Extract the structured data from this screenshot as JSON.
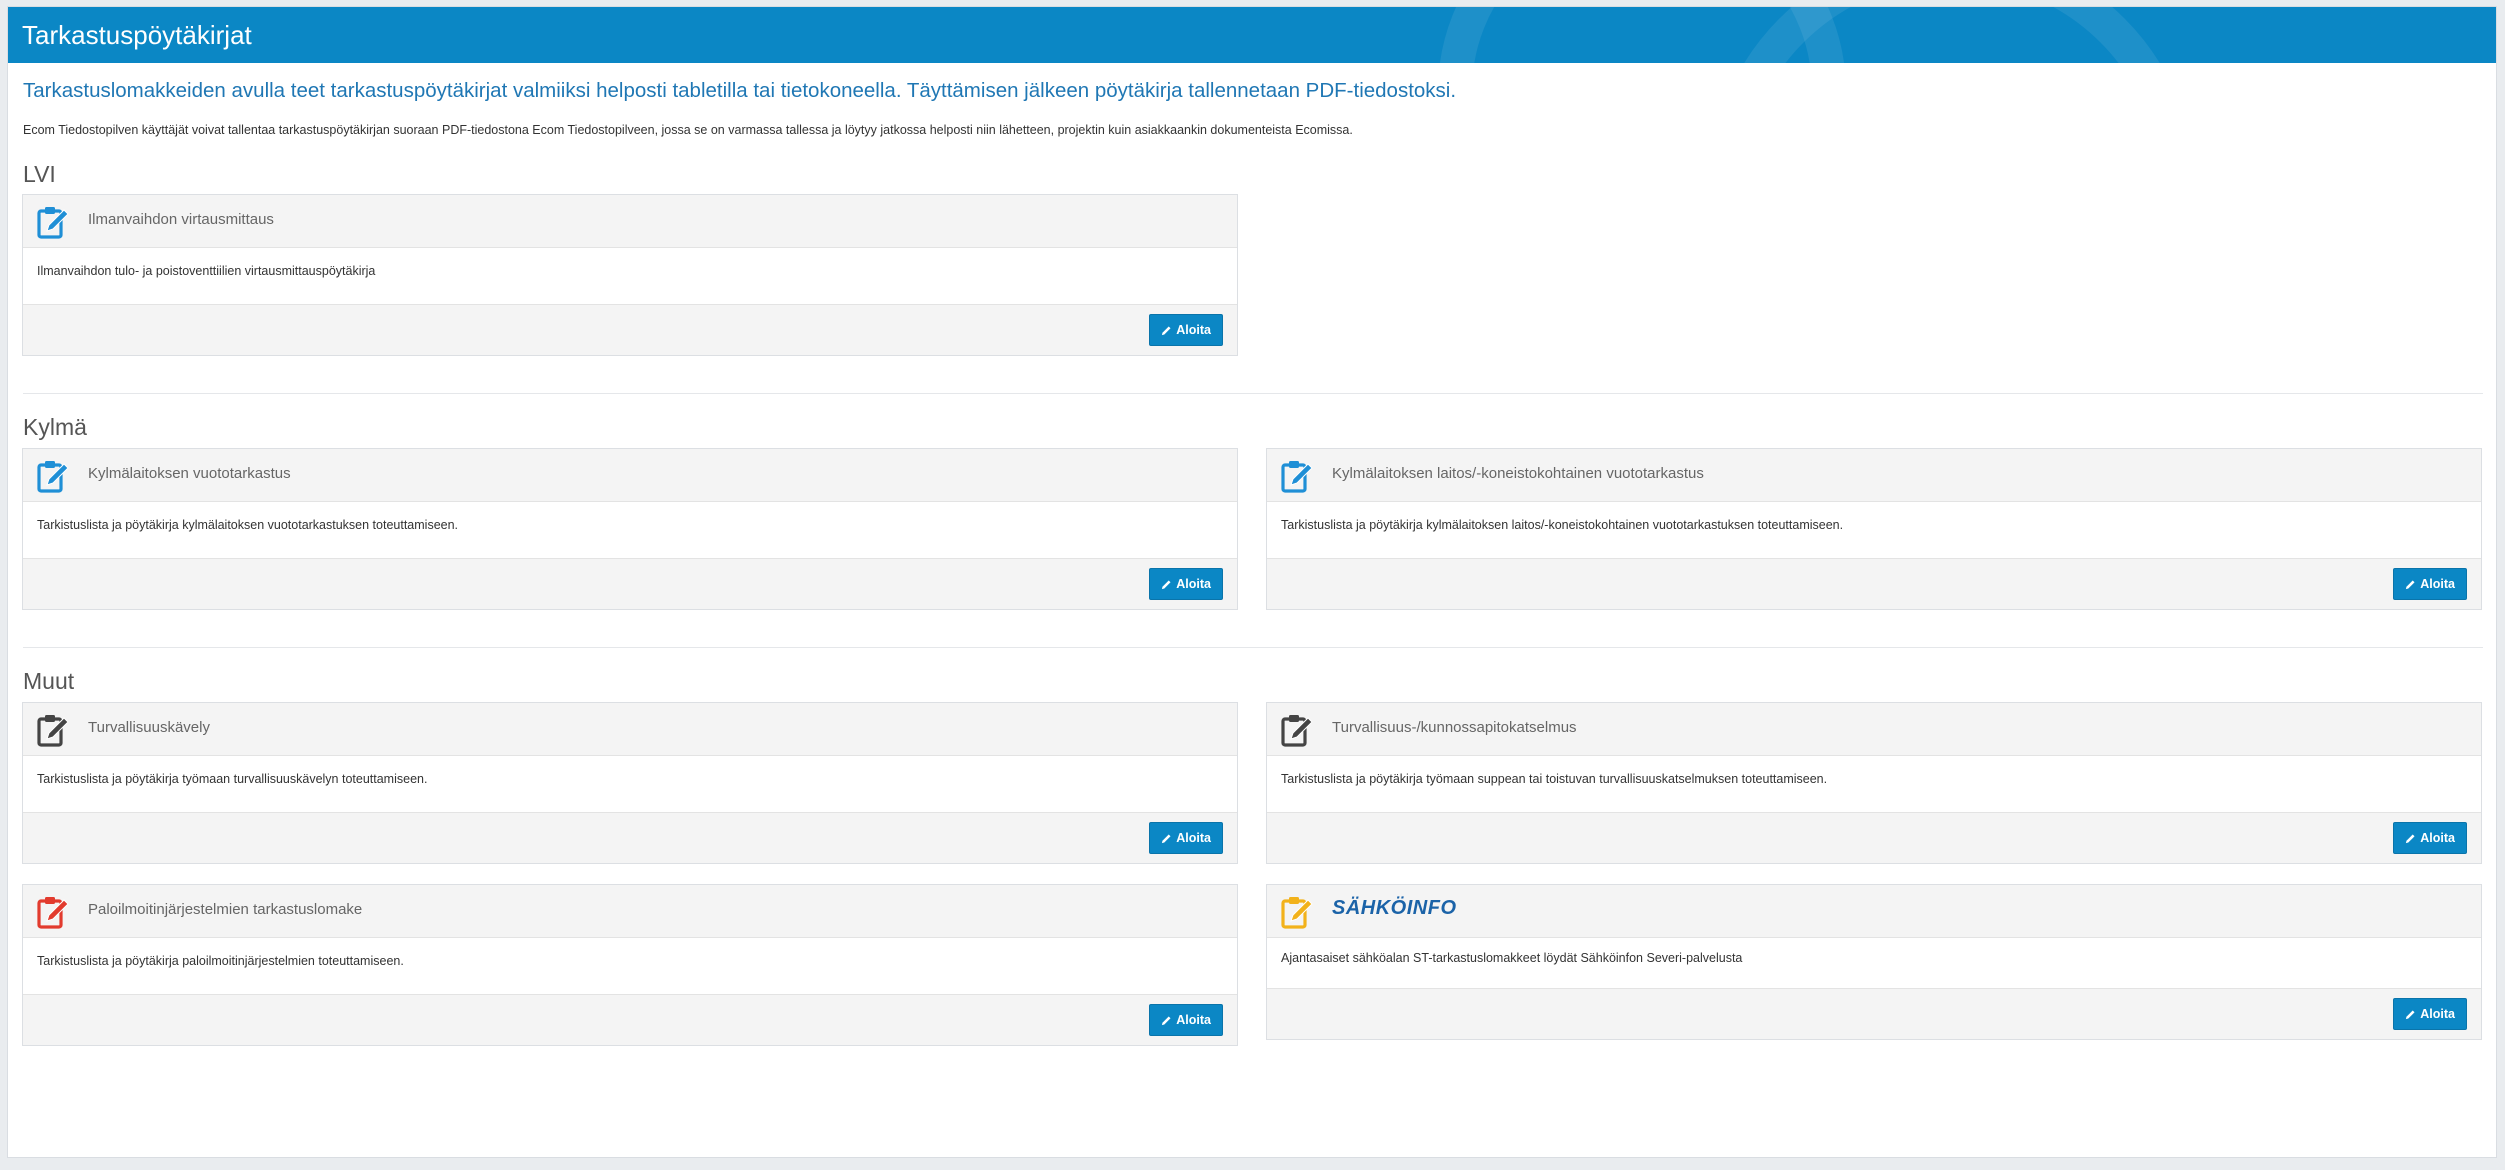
{
  "header": {
    "title": "Tarkastuspöytäkirjat"
  },
  "intro": "Tarkastuslomakkeiden avulla teet tarkastuspöytäkirjat valmiiksi helposti tabletilla tai tietokoneella. Täyttämisen jälkeen pöytäkirja tallennetaan PDF-tiedostoksi.",
  "note": "Ecom Tiedostopilven käyttäjät voivat tallentaa tarkastuspöytäkirjan suoraan PDF-tiedostona Ecom Tiedostopilveen, jossa se on varmassa tallessa ja löytyy jatkossa helposti niin lähetteen, projektin kuin asiakkaankin dokumenteista Ecomissa.",
  "start_label": "Aloita",
  "sections": [
    {
      "title": "LVI",
      "cards": [
        {
          "title": "Ilmanvaihdon virtausmittaus",
          "description": "Ilmanvaihdon tulo- ja poistoventtiilien virtausmittauspöytäkirja",
          "icon": "clipboard-pen-icon",
          "icon_color": "#1f8fd6"
        }
      ]
    },
    {
      "title": "Kylmä",
      "cards": [
        {
          "title": "Kylmälaitoksen vuototarkastus",
          "description": "Tarkistuslista ja pöytäkirja kylmälaitoksen vuototarkastuksen toteuttamiseen.",
          "icon": "clipboard-pen-icon",
          "icon_color": "#1f8fd6"
        },
        {
          "title": "Kylmälaitoksen laitos/-koneistokohtainen vuototarkastus",
          "description": "Tarkistuslista ja pöytäkirja kylmälaitoksen laitos/-koneistokohtainen vuototarkastuksen toteuttamiseen.",
          "icon": "clipboard-pen-icon",
          "icon_color": "#1f8fd6"
        }
      ]
    },
    {
      "title": "Muut",
      "cards": [
        {
          "title": "Turvallisuuskävely",
          "description": "Tarkistuslista ja pöytäkirja työmaan turvallisuuskävelyn toteuttamiseen.",
          "icon": "clipboard-pen-icon",
          "icon_color": "#444444"
        },
        {
          "title": "Turvallisuus-/kunnossapitokatselmus",
          "description": "Tarkistuslista ja pöytäkirja työmaan suppean tai toistuvan turvallisuuskatselmuksen toteuttamiseen.",
          "icon": "clipboard-pen-icon",
          "icon_color": "#444444"
        },
        {
          "title": "Paloilmoitinjärjestelmien tarkastuslomake",
          "description": "Tarkistuslista ja pöytäkirja paloilmoitinjärjestelmien toteuttamiseen.",
          "icon": "clipboard-pen-icon",
          "icon_color": "#e23b2e"
        },
        {
          "title": "SÄHKÖINFO",
          "description": "Ajantasaiset sähköalan ST-tarkastuslomakkeet löydät Sähköinfon Severi-palvelusta",
          "icon": "clipboard-pen-icon",
          "icon_color": "#f2b21b",
          "logo": true
        }
      ]
    }
  ],
  "colors": {
    "header_bg": "#0b87c5",
    "accent": "#0b87c5",
    "intro_text": "#1f77b4"
  }
}
